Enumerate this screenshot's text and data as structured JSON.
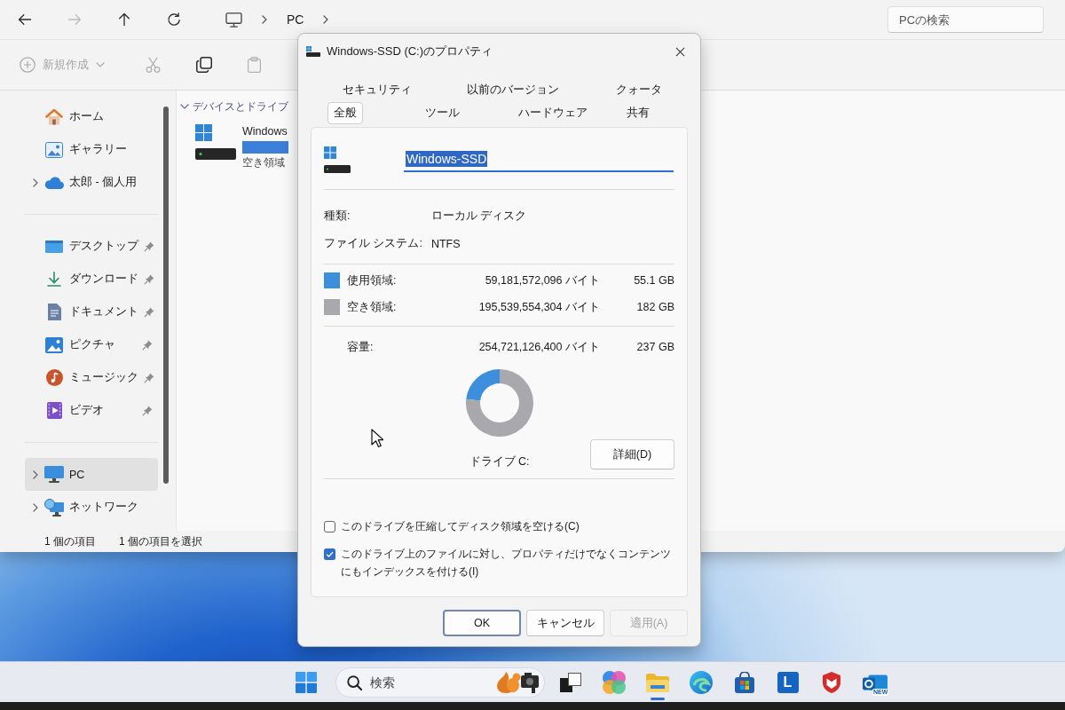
{
  "explorer": {
    "nav_buttons": [
      {
        "kind": "back",
        "disabled": false
      },
      {
        "kind": "forward",
        "disabled": true
      },
      {
        "kind": "up",
        "disabled": false
      },
      {
        "kind": "refresh",
        "disabled": false
      }
    ],
    "breadcrumb": [
      "PC"
    ],
    "search": {
      "placeholder": "PCの検索"
    },
    "toolbar": {
      "new_button": {
        "label": "新規作成",
        "disabled": true
      },
      "tools": [
        {
          "kind": "cut",
          "disabled": true
        },
        {
          "kind": "copy",
          "disabled": false
        },
        {
          "kind": "paste",
          "disabled": true
        }
      ]
    },
    "sidebar": {
      "sections": [
        {
          "items": [
            {
              "kind": "home",
              "label": "ホーム",
              "expandable": false,
              "pinned": false,
              "selected": false
            },
            {
              "kind": "gallery",
              "label": "ギャラリー",
              "expandable": false,
              "pinned": false,
              "selected": false
            },
            {
              "kind": "cloud",
              "label": "太郎 - 個人用",
              "expandable": true,
              "pinned": false,
              "selected": false
            }
          ]
        },
        {
          "items": [
            {
              "kind": "desktop",
              "label": "デスクトップ",
              "expandable": false,
              "pinned": true,
              "selected": false
            },
            {
              "kind": "download",
              "label": "ダウンロード",
              "expandable": false,
              "pinned": true,
              "selected": false
            },
            {
              "kind": "documents",
              "label": "ドキュメント",
              "expandable": false,
              "pinned": true,
              "selected": false
            },
            {
              "kind": "pictures",
              "label": "ピクチャ",
              "expandable": false,
              "pinned": true,
              "selected": false
            },
            {
              "kind": "music",
              "label": "ミュージック",
              "expandable": false,
              "pinned": true,
              "selected": false
            },
            {
              "kind": "videos",
              "label": "ビデオ",
              "expandable": false,
              "pinned": true,
              "selected": false
            }
          ]
        },
        {
          "items": [
            {
              "kind": "pc",
              "label": "PC",
              "expandable": true,
              "pinned": false,
              "selected": true
            },
            {
              "kind": "network",
              "label": "ネットワーク",
              "expandable": true,
              "pinned": false,
              "selected": false
            }
          ]
        }
      ]
    },
    "group": {
      "label": "デバイスとドライブ",
      "expanded": true
    },
    "drive": {
      "name": "Windows",
      "free_label": "空き領域"
    },
    "status_bar": [
      "1 個の項目",
      "1 個の項目を選択"
    ]
  },
  "dialog": {
    "title": "Windows-SSD (C:)のプロパティ",
    "tab_rows": [
      {
        "tabs": [
          {
            "label": "セキュリティ",
            "selected": false
          },
          {
            "label": "以前のバージョン",
            "selected": false
          },
          {
            "label": "クォータ",
            "selected": false
          }
        ]
      },
      {
        "tabs": [
          {
            "label": "全般",
            "selected": true
          },
          {
            "label": "ツール",
            "selected": false
          },
          {
            "label": "ハードウェア",
            "selected": false
          },
          {
            "label": "共有",
            "selected": false
          }
        ]
      }
    ],
    "name_field": {
      "value": "Windows-SSD",
      "text_selected": true
    },
    "info": [
      {
        "label": "種類:",
        "value": "ローカル ディスク"
      },
      {
        "label": "ファイル システム:",
        "value": "NTFS"
      }
    ],
    "usage": [
      {
        "label": "使用領域:",
        "bytes": "59,181,572,096 バイト",
        "size": "55.1 GB",
        "color": "#3d8fdc"
      },
      {
        "label": "空き領域:",
        "bytes": "195,539,554,304 バイト",
        "size": "182 GB",
        "color": "#a9a9ad"
      }
    ],
    "capacity": {
      "label": "容量:",
      "bytes": "254,721,126,400 バイト",
      "size": "237 GB"
    },
    "chart_data": {
      "type": "donut",
      "values": [
        23.2,
        76.8
      ]
    },
    "drive_label": "ドライブ C:",
    "details_button": "詳細(D)",
    "options": [
      {
        "label": "このドライブを圧縮してディスク領域を空ける(C)",
        "checked": false
      },
      {
        "label": "このドライブ上のファイルに対し、プロパティだけでなくコンテンツにもインデックスを付ける(I)",
        "checked": true
      }
    ],
    "buttons": [
      {
        "label": "OK",
        "default": true,
        "disabled": false
      },
      {
        "label": "キャンセル",
        "default": false,
        "disabled": false
      },
      {
        "label": "適用(A)",
        "default": false,
        "disabled": true
      }
    ]
  },
  "taskbar": {
    "search": {
      "placeholder": "検索"
    },
    "apps": [
      {
        "kind": "taskview",
        "active": false
      },
      {
        "kind": "assistant",
        "active": false
      },
      {
        "kind": "files",
        "active": true
      },
      {
        "kind": "browser",
        "active": false
      },
      {
        "kind": "store",
        "active": false
      },
      {
        "kind": "letter",
        "label": "L",
        "active": false
      },
      {
        "kind": "shield",
        "active": false
      },
      {
        "kind": "mail",
        "badge": "NEW",
        "active": false
      }
    ]
  }
}
